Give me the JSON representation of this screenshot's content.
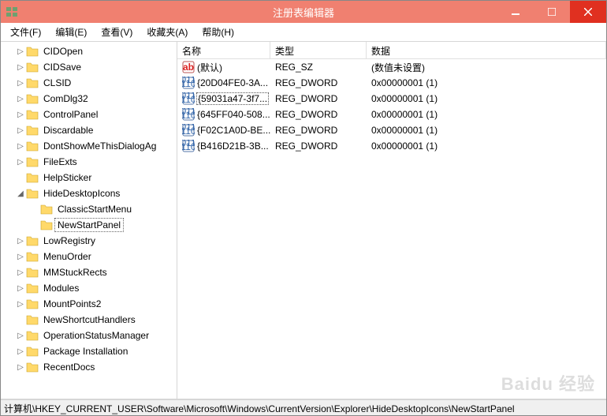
{
  "window": {
    "title": "注册表编辑器"
  },
  "menu": {
    "file": "文件(F)",
    "edit": "编辑(E)",
    "view": "查看(V)",
    "fav": "收藏夹(A)",
    "help": "帮助(H)"
  },
  "tree": {
    "items": [
      {
        "label": "CIDOpen",
        "depth": 1,
        "exp": "▷"
      },
      {
        "label": "CIDSave",
        "depth": 1,
        "exp": "▷"
      },
      {
        "label": "CLSID",
        "depth": 1,
        "exp": "▷"
      },
      {
        "label": "ComDlg32",
        "depth": 1,
        "exp": "▷"
      },
      {
        "label": "ControlPanel",
        "depth": 1,
        "exp": "▷"
      },
      {
        "label": "Discardable",
        "depth": 1,
        "exp": "▷"
      },
      {
        "label": "DontShowMeThisDialogAg",
        "depth": 1,
        "exp": "▷"
      },
      {
        "label": "FileExts",
        "depth": 1,
        "exp": "▷"
      },
      {
        "label": "HelpSticker",
        "depth": 1,
        "exp": ""
      },
      {
        "label": "HideDesktopIcons",
        "depth": 1,
        "exp": "◢"
      },
      {
        "label": "ClassicStartMenu",
        "depth": 2,
        "exp": ""
      },
      {
        "label": "NewStartPanel",
        "depth": 2,
        "exp": "",
        "selected": true
      },
      {
        "label": "LowRegistry",
        "depth": 1,
        "exp": "▷"
      },
      {
        "label": "MenuOrder",
        "depth": 1,
        "exp": "▷"
      },
      {
        "label": "MMStuckRects",
        "depth": 1,
        "exp": "▷"
      },
      {
        "label": "Modules",
        "depth": 1,
        "exp": "▷"
      },
      {
        "label": "MountPoints2",
        "depth": 1,
        "exp": "▷"
      },
      {
        "label": "NewShortcutHandlers",
        "depth": 1,
        "exp": ""
      },
      {
        "label": "OperationStatusManager",
        "depth": 1,
        "exp": "▷"
      },
      {
        "label": "Package Installation",
        "depth": 1,
        "exp": "▷"
      },
      {
        "label": "RecentDocs",
        "depth": 1,
        "exp": "▷"
      }
    ]
  },
  "list": {
    "headers": {
      "name": "名称",
      "type": "类型",
      "data": "数据"
    },
    "rows": [
      {
        "icon": "str",
        "name": "(默认)",
        "type": "REG_SZ",
        "data": "(数值未设置)"
      },
      {
        "icon": "bin",
        "name": "{20D04FE0-3A...",
        "type": "REG_DWORD",
        "data": "0x00000001 (1)"
      },
      {
        "icon": "bin",
        "name": "{59031a47-3f7...",
        "type": "REG_DWORD",
        "data": "0x00000001 (1)",
        "sel": true
      },
      {
        "icon": "bin",
        "name": "{645FF040-508...",
        "type": "REG_DWORD",
        "data": "0x00000001 (1)"
      },
      {
        "icon": "bin",
        "name": "{F02C1A0D-BE...",
        "type": "REG_DWORD",
        "data": "0x00000001 (1)"
      },
      {
        "icon": "bin",
        "name": "{B416D21B-3B...",
        "type": "REG_DWORD",
        "data": "0x00000001 (1)"
      }
    ]
  },
  "status": "计算机\\HKEY_CURRENT_USER\\Software\\Microsoft\\Windows\\CurrentVersion\\Explorer\\HideDesktopIcons\\NewStartPanel",
  "watermark": "Baidu 经验"
}
